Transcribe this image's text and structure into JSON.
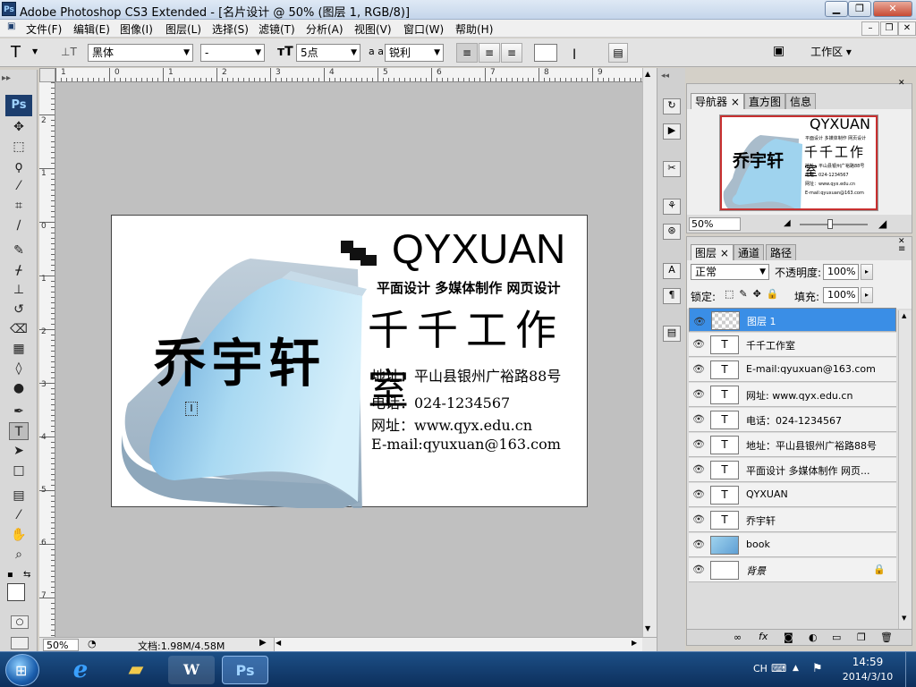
{
  "window": {
    "title": "Adobe Photoshop CS3 Extended - [名片设计 @ 50% (图层 1, RGB/8)]",
    "app_icon": "Ps"
  },
  "menu": [
    "文件(F)",
    "编辑(E)",
    "图像(I)",
    "图层(L)",
    "选择(S)",
    "滤镜(T)",
    "分析(A)",
    "视图(V)",
    "窗口(W)",
    "帮助(H)"
  ],
  "options": {
    "tool_glyph": "T",
    "font_family": "黑体",
    "font_style": "-",
    "font_size": "5点",
    "antialias_label": "a a",
    "antialias": "锐利",
    "workspace": "工作区"
  },
  "ruler_top": [
    "1",
    "0",
    "1",
    "2",
    "3",
    "4",
    "5",
    "6",
    "7",
    "8",
    "9"
  ],
  "ruler_left": [
    "2",
    "1",
    "0",
    "1",
    "2",
    "3",
    "4",
    "5",
    "6",
    "7"
  ],
  "toolbox": {
    "logo": "Ps"
  },
  "card": {
    "brand_name": "乔宇轩",
    "company_en": "QYXUAN",
    "services": "平面设计 多媒体制作 网页设计",
    "studio": "千千工作室",
    "address": "地址：平山县银州广裕路88号",
    "phone": "电话：024-1234567",
    "website": "网址：www.qyx.edu.cn",
    "email": "E-mail:qyuxuan@163.com"
  },
  "status": {
    "zoom": "50%",
    "doc": "文档:1.98M/4.58M"
  },
  "navigator": {
    "tabs": [
      "导航器",
      "直方图",
      "信息"
    ],
    "zoom": "50%"
  },
  "layers_panel": {
    "tabs": [
      "图层",
      "通道",
      "路径"
    ],
    "blend_mode": "正常",
    "opacity_label": "不透明度:",
    "opacity": "100%",
    "lock_label": "锁定:",
    "fill_label": "填充:",
    "fill": "100%",
    "layers": [
      {
        "name": "图层 1",
        "type": "raster",
        "selected": true
      },
      {
        "name": "千千工作室",
        "type": "text"
      },
      {
        "name": "E-mail:qyuxuan@163.com",
        "type": "text"
      },
      {
        "name": "网址: www.qyx.edu.cn",
        "type": "text"
      },
      {
        "name": "电话：024-1234567",
        "type": "text"
      },
      {
        "name": "地址：平山县银州广裕路88号",
        "type": "text"
      },
      {
        "name": "平面设计 多媒体制作 网页...",
        "type": "text"
      },
      {
        "name": "QYXUAN",
        "type": "text"
      },
      {
        "name": "乔宇轩",
        "type": "text"
      },
      {
        "name": "book",
        "type": "smart"
      },
      {
        "name": "背景",
        "type": "background"
      }
    ]
  },
  "taskbar": {
    "ime": "CH",
    "time": "14:59",
    "date": "2014/3/10"
  },
  "colors": {
    "accent": "#3a8ee6",
    "canvas_bg": "#c0c0c0",
    "book_blue": "#9fd3ee"
  }
}
